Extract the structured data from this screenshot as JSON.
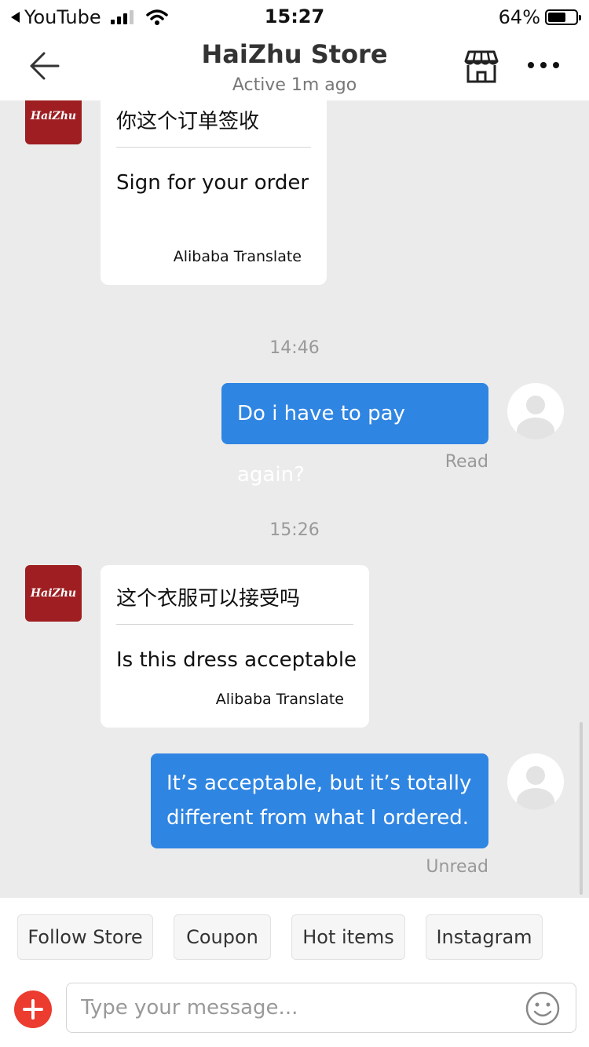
{
  "status_bar": {
    "back_app": "YouTube",
    "time": "15:27",
    "battery": "64%",
    "battery_level": 0.64
  },
  "header": {
    "title": "HaiZhu Store",
    "subtitle": "Active 1m ago",
    "icons": [
      "back-arrow-icon",
      "store-icon",
      "more-icon"
    ]
  },
  "store_logo": "HaiZhu",
  "messages": [
    {
      "type": "incoming",
      "original": "你这个订单签收",
      "translation": "Sign for your order",
      "source": "Alibaba Translate"
    },
    {
      "type": "time",
      "text": "14:46"
    },
    {
      "type": "outgoing",
      "text": "Do i have to pay again?",
      "status": "Read"
    },
    {
      "type": "time",
      "text": "15:26"
    },
    {
      "type": "incoming",
      "original": "这个衣服可以接受吗",
      "translation": "Is this dress acceptable",
      "source": "Alibaba Translate"
    },
    {
      "type": "outgoing",
      "lines": [
        "It’s acceptable, but it’s totally",
        "different from what I ordered."
      ],
      "status": "Unread"
    }
  ],
  "quick_replies": [
    "Follow Store",
    "Coupon",
    "Hot items",
    "Instagram"
  ],
  "composer": {
    "placeholder": "Type your message...",
    "accent": "#ec3b2f"
  },
  "colors": {
    "outgoing_bubble": "#2f85e2",
    "store_avatar": "#9e1e22",
    "chat_background": "#ebebeb"
  }
}
